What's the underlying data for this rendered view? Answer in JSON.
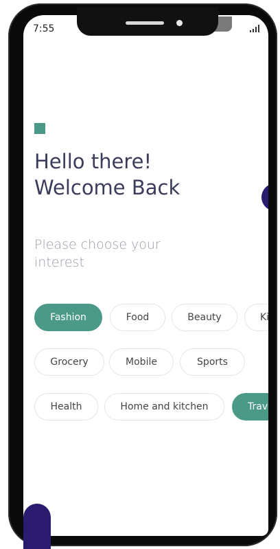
{
  "status_bar": {
    "time": "7:55"
  },
  "header": {
    "title": "Hello there!\nWelcome Back",
    "subtitle": "Please choose your interest"
  },
  "interests": {
    "row1": [
      "Fashion",
      "Food",
      "Beauty",
      "Ki"
    ],
    "row2": [
      "Grocery",
      "Mobile",
      "Sports"
    ],
    "row3": [
      "Health",
      "Home and kitchen",
      "Trave"
    ],
    "selected": [
      "Fashion",
      "Trave"
    ]
  },
  "colors": {
    "accent": "#4b9a88",
    "deep_purple": "#2b1b6e",
    "title_text": "#3b3b5c",
    "subtitle_text": "#9a9aa8"
  }
}
